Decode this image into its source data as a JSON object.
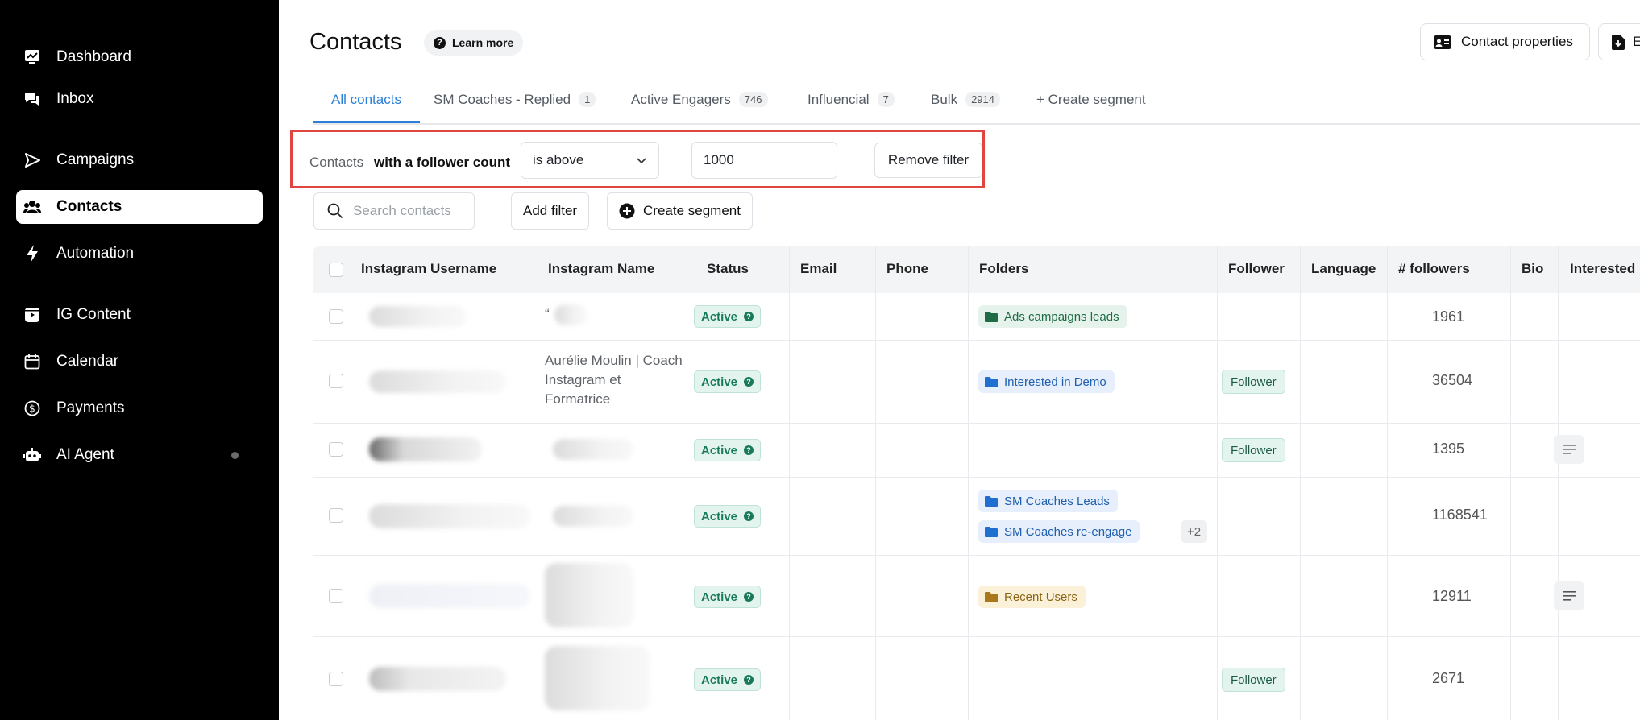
{
  "sidebar": {
    "items": [
      {
        "label": "Dashboard",
        "icon": "dashboard-icon"
      },
      {
        "label": "Inbox",
        "icon": "inbox-icon"
      },
      {
        "label": "Campaigns",
        "icon": "send-icon"
      },
      {
        "label": "Contacts",
        "icon": "contacts-icon",
        "active": true
      },
      {
        "label": "Automation",
        "icon": "lightning-icon"
      },
      {
        "label": "IG Content",
        "icon": "ig-content-icon"
      },
      {
        "label": "Calendar",
        "icon": "calendar-icon"
      },
      {
        "label": "Payments",
        "icon": "dollar-icon"
      },
      {
        "label": "AI Agent",
        "icon": "robot-icon"
      }
    ]
  },
  "header": {
    "title": "Contacts",
    "learn_more": "Learn more",
    "contact_properties": "Contact properties",
    "export_partial": "E"
  },
  "tabs": [
    {
      "label": "All contacts",
      "count": null,
      "active": true
    },
    {
      "label": "SM Coaches - Replied",
      "count": "1"
    },
    {
      "label": "Active Engagers",
      "count": "746"
    },
    {
      "label": "Influencial",
      "count": "7"
    },
    {
      "label": "Bulk",
      "count": "2914"
    }
  ],
  "create_segment_tab": "+ Create segment",
  "filter": {
    "subject": "Contacts",
    "field": "with a follower count",
    "operator": "is above",
    "value": "1000",
    "remove_label": "Remove filter"
  },
  "toolbar": {
    "search_placeholder": "Search contacts",
    "add_filter": "Add filter",
    "create_segment": "Create segment"
  },
  "table": {
    "columns": [
      "Instagram Username",
      "Instagram Name",
      "Status",
      "Email",
      "Phone",
      "Folders",
      "Follower",
      "Language",
      "# followers",
      "Bio",
      "Interested"
    ],
    "rows": [
      {
        "name": "“",
        "status": "Active",
        "folders": [
          "Ads campaigns leads"
        ],
        "follower": "",
        "followers": "1961"
      },
      {
        "name": "Aurélie Moulin | Coach Instagram et Formatrice",
        "status": "Active",
        "folders": [
          "Interested in Demo"
        ],
        "follower": "Follower",
        "followers": "36504"
      },
      {
        "name": "",
        "status": "Active",
        "folders": [],
        "follower": "Follower",
        "followers": "1395"
      },
      {
        "name": "",
        "status": "Active",
        "folders": [
          "SM Coaches Leads",
          "SM Coaches re-engage"
        ],
        "more": "+2",
        "follower": "",
        "followers": "1168541"
      },
      {
        "name": "",
        "status": "Active",
        "folders": [
          "Recent Users"
        ],
        "follower": "",
        "followers": "12911"
      },
      {
        "name": "",
        "status": "Active",
        "folders": [],
        "follower": "Follower",
        "followers": "2671"
      }
    ]
  },
  "colors": {
    "accent": "#2b7fd6",
    "highlight_border": "#e0463f",
    "status_green": "#187a5a",
    "sidebar_bg": "#000000"
  }
}
